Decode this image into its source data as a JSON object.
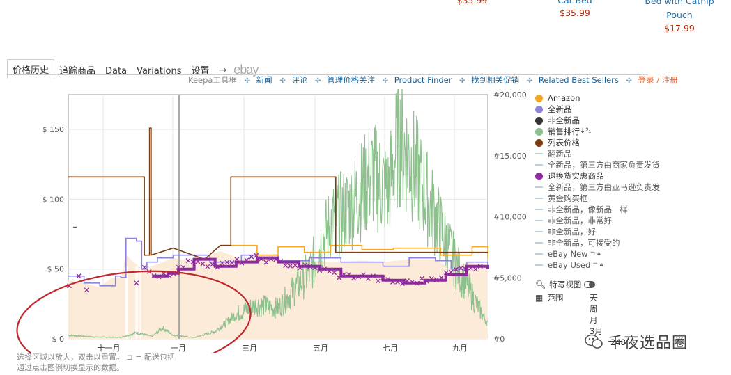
{
  "products": [
    {
      "name": "",
      "price": "$35.99"
    },
    {
      "name": "Cat Bed",
      "price": "$35.99"
    },
    {
      "name": "Bed with Catnip Pouch",
      "price": "$17.99"
    }
  ],
  "tabs": [
    "价格历史",
    "追踪商品",
    "Data",
    "Variations",
    "设置",
    "→",
    "ebay"
  ],
  "toolbar": {
    "label": "Keepa工具框",
    "links": [
      "新闻",
      "评论",
      "管理价格关注",
      "Product Finder",
      "找到相关促销",
      "Related Best Sellers"
    ],
    "login": "登录 / 注册"
  },
  "legend": [
    {
      "label": "Amazon",
      "marker": "dot",
      "color": "#f5a623"
    },
    {
      "label": "全新品",
      "marker": "dot",
      "color": "#8b84d7"
    },
    {
      "label": "非全新品",
      "marker": "dot",
      "color": "#333333"
    },
    {
      "label": "销售排行",
      "marker": "dot",
      "color": "#8cc08c",
      "extra": "↓⁹₁"
    },
    {
      "label": "列表价格",
      "marker": "dot",
      "color": "#7a3e12"
    },
    {
      "label": "翻新品",
      "marker": "line",
      "color": "#b8cfd6"
    },
    {
      "label": "全新品，第三方由商家负责发货",
      "marker": "line",
      "color": "#b8cfd6"
    },
    {
      "label": "退换货实惠商品",
      "marker": "dot",
      "color": "#8e2a9f"
    },
    {
      "label": "全新品，第三方由亚马逊负责发",
      "marker": "line",
      "color": "#b8cfd6"
    },
    {
      "label": "黄金购买框",
      "marker": "line",
      "color": "#b8cfd6"
    },
    {
      "label": "非全新品，像新品一样",
      "marker": "line",
      "color": "#b8cfd6"
    },
    {
      "label": "非全新品，非常好",
      "marker": "line",
      "color": "#b8cfd6"
    },
    {
      "label": "非全新品，好",
      "marker": "line",
      "color": "#b8cfd6"
    },
    {
      "label": "非全新品，可接受的",
      "marker": "line",
      "color": "#b8cfd6"
    },
    {
      "label": "eBay New",
      "marker": "line",
      "color": "#b8cfd6",
      "locked": true
    },
    {
      "label": "eBay Used",
      "marker": "line",
      "color": "#b8cfd6",
      "locked": true
    }
  ],
  "options": {
    "closeup": "特写视图",
    "range": "范围"
  },
  "ranges": [
    "天",
    "周",
    "月",
    "3月",
    "248"
  ],
  "footer": {
    "line1": "选择区域以放大，双击以重置。    ⊐ = 配送包括",
    "line2": "通过点击图例切换显示的数据。"
  },
  "watermark": "千夜选品圈",
  "colors": {
    "list_price": "#7a3e12",
    "amazon": "#f5a623",
    "new": "#8b84d7",
    "sales_rank": "#8cc08c",
    "warehouse": "#8e2a9f",
    "fill": "#fdebd9",
    "annotation": "#c0282d"
  },
  "chart_data": {
    "type": "line",
    "x_ticks": [
      "十一月",
      "一月",
      "三月",
      "五月",
      "七月",
      "九月"
    ],
    "y_left_ticks": [
      "$ 0",
      "$ 50",
      "$ 100",
      "$ 150"
    ],
    "y_right_ticks": [
      "#0",
      "#5,000",
      "#10,000",
      "#15,000",
      "#20,000"
    ],
    "ylim_price": [
      0,
      175
    ],
    "ylim_rank": [
      0,
      20000
    ],
    "grid": true,
    "x_label": "",
    "y_label": "",
    "series": [
      {
        "name": "列表价格",
        "axis": "price",
        "points": [
          [
            0,
            116
          ],
          [
            0.5,
            116
          ],
          [
            1.45,
            116
          ],
          [
            1.45,
            60
          ],
          [
            1.55,
            60
          ],
          [
            1.55,
            151
          ],
          [
            1.58,
            151
          ],
          [
            1.58,
            60
          ],
          [
            2.0,
            65
          ],
          [
            2.6,
            57
          ],
          [
            2.9,
            67
          ],
          [
            3.1,
            67
          ],
          [
            3.1,
            116
          ],
          [
            5.1,
            116
          ],
          [
            5.1,
            62
          ],
          [
            8.0,
            62
          ]
        ]
      },
      {
        "name": "Amazon",
        "axis": "price",
        "points": [
          [
            2.9,
            67
          ],
          [
            3.6,
            60
          ],
          [
            4.0,
            66
          ],
          [
            4.5,
            62
          ],
          [
            5.0,
            67
          ],
          [
            5.6,
            64
          ],
          [
            6.2,
            65
          ],
          [
            7.1,
            60
          ],
          [
            7.7,
            66
          ],
          [
            8.0,
            58
          ]
        ]
      },
      {
        "name": "全新品",
        "axis": "price",
        "points": [
          [
            0,
            45
          ],
          [
            0.3,
            40
          ],
          [
            0.6,
            38
          ],
          [
            0.9,
            45
          ],
          [
            1.0,
            44
          ],
          [
            1.1,
            72
          ],
          [
            1.3,
            70
          ],
          [
            1.4,
            50
          ],
          [
            1.5,
            55
          ],
          [
            1.7,
            58
          ],
          [
            2.0,
            60
          ],
          [
            2.7,
            55
          ],
          [
            3.3,
            60
          ],
          [
            4.0,
            56
          ],
          [
            4.6,
            58
          ],
          [
            5.2,
            55
          ],
          [
            6.0,
            52
          ],
          [
            6.5,
            58
          ],
          [
            7.0,
            56
          ],
          [
            7.3,
            50
          ],
          [
            7.6,
            55
          ],
          [
            8.0,
            52
          ]
        ]
      },
      {
        "name": "销售排行",
        "axis": "rank",
        "points": [
          [
            0,
            300
          ],
          [
            0.5,
            150
          ],
          [
            1.0,
            120
          ],
          [
            1.3,
            500
          ],
          [
            1.6,
            200
          ],
          [
            1.8,
            900
          ],
          [
            2.0,
            300
          ],
          [
            2.4,
            100
          ],
          [
            2.8,
            600
          ],
          [
            3.2,
            2000
          ],
          [
            3.6,
            2800
          ],
          [
            4.0,
            2500
          ],
          [
            4.2,
            3500
          ],
          [
            4.6,
            5500
          ],
          [
            5.0,
            9500
          ],
          [
            5.4,
            11000
          ],
          [
            5.8,
            13500
          ],
          [
            6.1,
            12000
          ],
          [
            6.3,
            16500
          ],
          [
            6.6,
            14000
          ],
          [
            6.9,
            11000
          ],
          [
            7.1,
            9000
          ],
          [
            7.4,
            6000
          ],
          [
            7.7,
            3500
          ],
          [
            8.0,
            1200
          ]
        ]
      },
      {
        "name": "退换货实惠商品",
        "axis": "price",
        "points": [
          [
            1.6,
            45
          ],
          [
            1.9,
            47
          ],
          [
            2.1,
            50
          ],
          [
            2.4,
            57
          ],
          [
            2.8,
            52
          ],
          [
            3.2,
            55
          ],
          [
            3.6,
            58
          ],
          [
            4.0,
            55
          ],
          [
            4.4,
            52
          ],
          [
            4.8,
            50
          ],
          [
            5.2,
            45
          ],
          [
            5.6,
            45
          ],
          [
            6.0,
            42
          ],
          [
            6.4,
            40
          ],
          [
            6.8,
            42
          ],
          [
            7.2,
            46
          ],
          [
            7.6,
            52
          ],
          [
            8.0,
            50
          ]
        ]
      }
    ]
  }
}
